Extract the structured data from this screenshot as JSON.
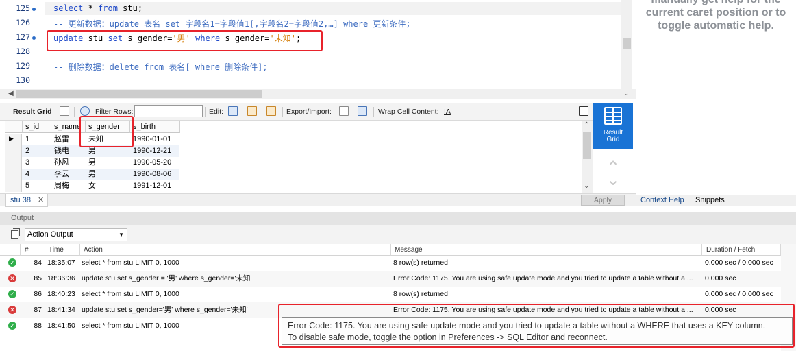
{
  "editor": {
    "lines": [
      {
        "num": "125",
        "marker": true
      },
      {
        "num": "126",
        "marker": false
      },
      {
        "num": "127",
        "marker": true
      },
      {
        "num": "128",
        "marker": false
      },
      {
        "num": "129",
        "marker": false
      },
      {
        "num": "130",
        "marker": false
      }
    ],
    "code125": {
      "kw1": "select",
      "t1": " * ",
      "kw2": "from",
      "t2": " stu;"
    },
    "code126": {
      "text": "-- 更新数据：update 表名 set 字段名1=字段值1[,字段名2=字段值2,…] where 更新条件;"
    },
    "code127": {
      "kw1": "update",
      "t1": " stu ",
      "kw2": "set",
      "t2": " s_gender=",
      "s1": "'男'",
      "t3": " ",
      "kw3": "where",
      "t4": " s_gender=",
      "s2": "'未知'",
      "t5": ";"
    },
    "code129": {
      "text": "-- 删除数据：delete from 表名[ where 删除条件];"
    }
  },
  "help": {
    "lines": [
      "manually get help for the",
      "current caret position or to",
      "toggle automatic help."
    ],
    "tabs": [
      "Context Help",
      "Snippets"
    ]
  },
  "result_toolbar": {
    "result_grid": "Result Grid",
    "filter_rows": "Filter Rows:",
    "filter_value": "",
    "edit": "Edit:",
    "export_import": "Export/Import:",
    "wrap_cell": "Wrap Cell Content:",
    "wrap_icon": "IA"
  },
  "result_grid_button": {
    "line1": "Result",
    "line2": "Grid"
  },
  "grid": {
    "columns": [
      "s_id",
      "s_name",
      "s_gender",
      "s_birth"
    ],
    "rows": [
      {
        "s_id": "1",
        "s_name": "赵雷",
        "s_gender": "未知",
        "s_birth": "1990-01-01"
      },
      {
        "s_id": "2",
        "s_name": "钱电",
        "s_gender": "男",
        "s_birth": "1990-12-21"
      },
      {
        "s_id": "3",
        "s_name": "孙风",
        "s_gender": "男",
        "s_birth": "1990-05-20"
      },
      {
        "s_id": "4",
        "s_name": "李云",
        "s_gender": "男",
        "s_birth": "1990-08-06"
      },
      {
        "s_id": "5",
        "s_name": "周梅",
        "s_gender": "女",
        "s_birth": "1991-12-01"
      }
    ]
  },
  "tab": {
    "label": "stu 38"
  },
  "apply_label": "Apply",
  "output": {
    "title": "Output",
    "selector": "Action Output",
    "columns": [
      "#",
      "Time",
      "Action",
      "Message",
      "Duration / Fetch"
    ],
    "rows": [
      {
        "status": "ok",
        "num": "84",
        "time": "18:35:07",
        "action": "select * from stu LIMIT 0, 1000",
        "message": "8 row(s) returned",
        "duration": "0.000 sec / 0.000 sec"
      },
      {
        "status": "err",
        "num": "85",
        "time": "18:36:36",
        "action": "update stu set s_gender = '男' where s_gender='未知'",
        "message": "Error Code: 1175. You are using safe update mode and you tried to update a table without a ...",
        "duration": "0.000 sec"
      },
      {
        "status": "ok",
        "num": "86",
        "time": "18:40:23",
        "action": "select * from stu LIMIT 0, 1000",
        "message": "8 row(s) returned",
        "duration": "0.000 sec / 0.000 sec"
      },
      {
        "status": "err",
        "num": "87",
        "time": "18:41:34",
        "action": "update stu set s_gender='男' where s_gender='未知'",
        "message": "Error Code: 1175. You are using safe update mode and you tried to update a table without a ...",
        "duration": "0.000 sec"
      },
      {
        "status": "ok",
        "num": "88",
        "time": "18:41:50",
        "action": "select * from stu LIMIT 0, 1000",
        "message": "",
        "duration": ""
      }
    ],
    "tooltip": {
      "line1": "Error Code: 1175. You are using safe update mode and you tried to update a table without a WHERE that uses a KEY column.",
      "line2": "To disable safe mode, toggle the option in Preferences -> SQL Editor and reconnect."
    }
  },
  "colors": {
    "accent": "#1973d5",
    "highlight_box": "#e8232b",
    "keyword": "#1d47c8",
    "string": "#d47a00"
  }
}
